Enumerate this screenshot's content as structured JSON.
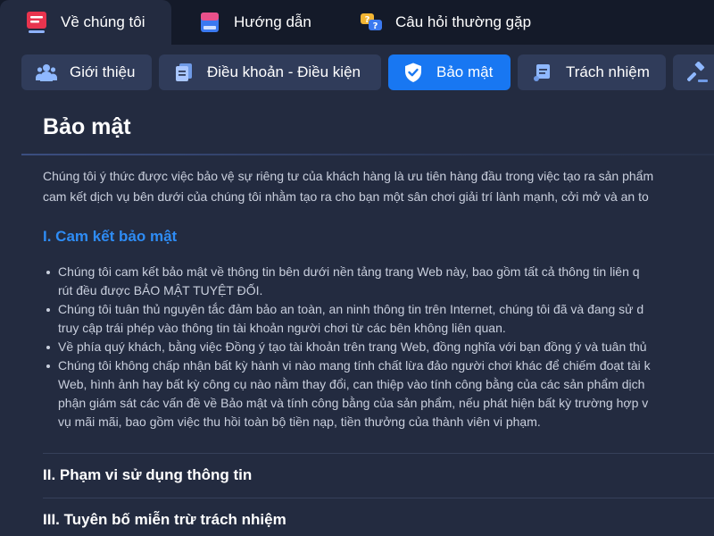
{
  "top_tabs": [
    {
      "label": "Về chúng tôi",
      "icon": "document-icon",
      "active": true
    },
    {
      "label": "Hướng dẫn",
      "icon": "book-icon",
      "active": false
    },
    {
      "label": "Câu hỏi thường gặp",
      "icon": "question-chat-icon",
      "active": false
    }
  ],
  "sub_tabs": [
    {
      "label": "Giới thiệu",
      "icon": "users-icon",
      "active": false
    },
    {
      "label": "Điều khoản - Điều kiện",
      "icon": "documents-icon",
      "active": false
    },
    {
      "label": "Bảo mật",
      "icon": "shield-check-icon",
      "active": true
    },
    {
      "label": "Trách nhiệm",
      "icon": "scroll-icon",
      "active": false
    },
    {
      "label": "",
      "icon": "gavel-icon",
      "active": false
    }
  ],
  "content": {
    "title": "Bảo mật",
    "intro_lines": [
      "Chúng tôi ý thức được việc bảo vệ sự riêng tư của khách hàng là ưu tiên hàng đầu trong việc tạo ra sản phẩm",
      "cam kết dịch vụ bên dưới của chúng tôi nhằm tạo ra cho bạn một sân chơi giải trí lành mạnh, cởi mở và an to"
    ],
    "section_1": {
      "heading": "I. Cam kết bảo mật",
      "bullets": [
        [
          "Chúng tôi cam kết bảo mật về thông tin bên dưới nền tảng trang Web này, bao gồm tất cả thông tin liên q",
          "rút đều được BẢO MẬT TUYỆT ĐỐI."
        ],
        [
          "Chúng tôi tuân thủ nguyên tắc đảm bảo an toàn, an ninh thông tin trên Internet, chúng tôi đã và đang sử d",
          "truy cập trái phép vào thông tin tài khoản người chơi từ các bên không liên quan."
        ],
        [
          "Về phía quý khách, bằng việc Đồng ý tạo tài khoản trên trang Web, đồng nghĩa với bạn đồng ý và tuân thủ"
        ],
        [
          "Chúng tôi không chấp nhận bất kỳ hành vi nào mang tính chất lừa đảo người chơi khác để chiếm đoạt tài k",
          "Web, hình ảnh hay bất kỳ công cụ nào nằm thay đổi, can thiệp vào tính công bằng của các sản phẩm dịch",
          "phận giám sát các vấn đề về Bảo mật và tính công bằng của sản phẩm, nếu phát hiện bất kỳ trường hợp v",
          "vụ mãi mãi, bao gồm việc thu hồi toàn bộ tiền nạp, tiền thưởng của thành viên vi phạm."
        ]
      ]
    },
    "section_2": {
      "heading": "II. Phạm vi sử dụng thông tin"
    },
    "section_3": {
      "heading": "III. Tuyên bố miễn trừ trách nhiệm"
    }
  },
  "colors": {
    "background": "#1b2235",
    "panel": "#232b40",
    "tab_bar": "#141a29",
    "active_accent": "#1877f2",
    "heading_blue": "#2e8cf5"
  }
}
